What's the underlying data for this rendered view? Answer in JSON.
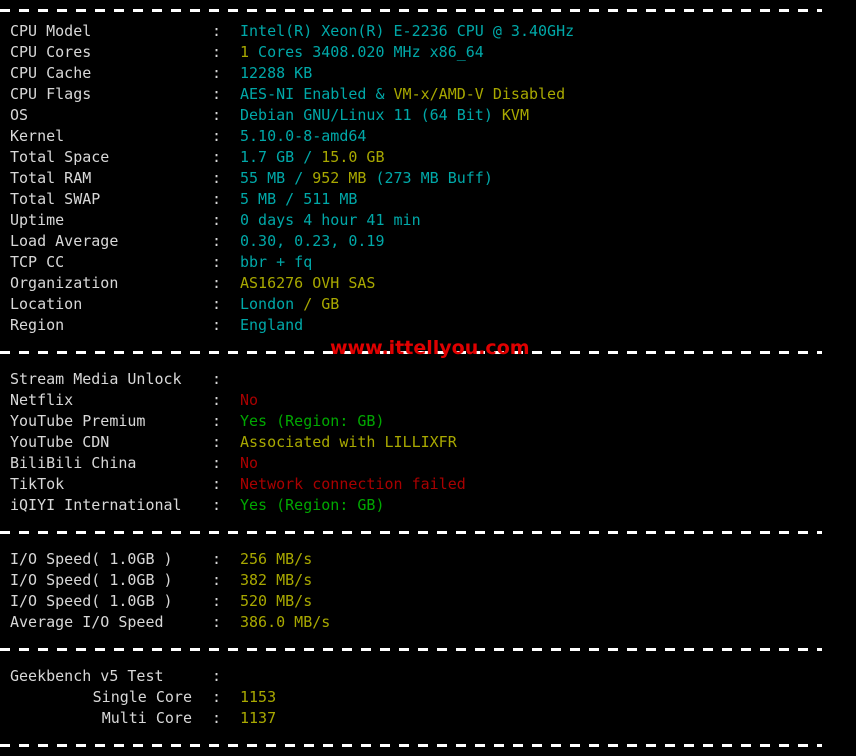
{
  "watermark": {
    "text": "www.ittellyou.com",
    "color": "#e00000"
  },
  "colors": {
    "background": "#000000",
    "label": "#d8d8d8",
    "cyan": "#00a8a8",
    "yellow": "#a8a800",
    "green": "#00a800",
    "red": "#a80000"
  },
  "separator": {
    "char": "-"
  },
  "sections": [
    {
      "id": "system-info",
      "rows": [
        {
          "label": "CPU Model",
          "colon": ":",
          "parts": [
            {
              "text": "Intel(R) Xeon(R) E-2236 CPU @ 3.40GHz",
              "color": "cyan"
            }
          ]
        },
        {
          "label": "CPU Cores",
          "colon": ":",
          "parts": [
            {
              "text": "1",
              "color": "yellow"
            },
            {
              "text": " Cores ",
              "color": "cyan"
            },
            {
              "text": "3408.020",
              "color": "cyan"
            },
            {
              "text": " MHz ",
              "color": "cyan"
            },
            {
              "text": "x86_64",
              "color": "cyan"
            }
          ]
        },
        {
          "label": "CPU Cache",
          "colon": ":",
          "parts": [
            {
              "text": "12288 KB",
              "color": "cyan"
            }
          ]
        },
        {
          "label": "CPU Flags",
          "colon": ":",
          "parts": [
            {
              "text": "AES-NI Enabled",
              "color": "cyan"
            },
            {
              "text": " & ",
              "color": "cyan"
            },
            {
              "text": "VM-x/AMD-V Disabled",
              "color": "yellow"
            }
          ]
        },
        {
          "label": "OS",
          "colon": ":",
          "parts": [
            {
              "text": "Debian GNU/Linux 11 (64 Bit) ",
              "color": "cyan"
            },
            {
              "text": "KVM",
              "color": "yellow"
            }
          ]
        },
        {
          "label": "Kernel",
          "colon": ":",
          "parts": [
            {
              "text": "5.10.0-8-amd64",
              "color": "cyan"
            }
          ]
        },
        {
          "label": "Total Space",
          "colon": ":",
          "parts": [
            {
              "text": "1.7 GB ",
              "color": "cyan"
            },
            {
              "text": "/ ",
              "color": "cyan"
            },
            {
              "text": "15.0 GB",
              "color": "yellow"
            }
          ]
        },
        {
          "label": "Total RAM",
          "colon": ":",
          "parts": [
            {
              "text": "55 MB ",
              "color": "cyan"
            },
            {
              "text": "/ ",
              "color": "cyan"
            },
            {
              "text": "952 MB",
              "color": "yellow"
            },
            {
              "text": " (273 MB Buff)",
              "color": "cyan"
            }
          ]
        },
        {
          "label": "Total SWAP",
          "colon": ":",
          "parts": [
            {
              "text": "5 MB / 511 MB",
              "color": "cyan"
            }
          ]
        },
        {
          "label": "Uptime",
          "colon": ":",
          "parts": [
            {
              "text": "0 days 4 hour 41 min",
              "color": "cyan"
            }
          ]
        },
        {
          "label": "Load Average",
          "colon": ":",
          "parts": [
            {
              "text": "0.30, 0.23, 0.19",
              "color": "cyan"
            }
          ]
        },
        {
          "label": "TCP CC",
          "colon": ":",
          "parts": [
            {
              "text": "bbr + fq",
              "color": "cyan"
            }
          ]
        },
        {
          "label": "Organization",
          "colon": ":",
          "parts": [
            {
              "text": "AS16276 OVH SAS",
              "color": "yellow"
            }
          ]
        },
        {
          "label": "Location",
          "colon": ":",
          "parts": [
            {
              "text": "London ",
              "color": "cyan"
            },
            {
              "text": "/ GB",
              "color": "yellow"
            }
          ]
        },
        {
          "label": "Region",
          "colon": ":",
          "parts": [
            {
              "text": "England",
              "color": "cyan"
            }
          ]
        }
      ]
    },
    {
      "id": "stream-media-unlock",
      "rows": [
        {
          "label": "Stream Media Unlock",
          "colon": ":",
          "parts": []
        },
        {
          "label": "Netflix",
          "colon": ":",
          "parts": [
            {
              "text": "No",
              "color": "red"
            }
          ]
        },
        {
          "label": "YouTube Premium",
          "colon": ":",
          "parts": [
            {
              "text": "Yes (Region: GB)",
              "color": "green"
            }
          ]
        },
        {
          "label": "YouTube CDN",
          "colon": ":",
          "parts": [
            {
              "text": "Associated with LILLIXFR",
              "color": "yellow"
            }
          ]
        },
        {
          "label": "BiliBili China",
          "colon": ":",
          "parts": [
            {
              "text": "No",
              "color": "red"
            }
          ]
        },
        {
          "label": "TikTok",
          "colon": ":",
          "parts": [
            {
              "text": "Network connection failed",
              "color": "red"
            }
          ]
        },
        {
          "label": "iQIYI International",
          "colon": ":",
          "parts": [
            {
              "text": "Yes (Region: GB)",
              "color": "green"
            }
          ]
        }
      ]
    },
    {
      "id": "io-speed",
      "rows": [
        {
          "label": "I/O Speed( 1.0GB )",
          "colon": ":",
          "parts": [
            {
              "text": "256 MB/s",
              "color": "yellow"
            }
          ]
        },
        {
          "label": "I/O Speed( 1.0GB )",
          "colon": ":",
          "parts": [
            {
              "text": "382 MB/s",
              "color": "yellow"
            }
          ]
        },
        {
          "label": "I/O Speed( 1.0GB )",
          "colon": ":",
          "parts": [
            {
              "text": "520 MB/s",
              "color": "yellow"
            }
          ]
        },
        {
          "label": "Average I/O Speed",
          "colon": ":",
          "parts": [
            {
              "text": "386.0 MB/s",
              "color": "yellow"
            }
          ]
        }
      ]
    },
    {
      "id": "geekbench",
      "rows": [
        {
          "label": "Geekbench v5 Test",
          "colon": ":",
          "parts": []
        },
        {
          "label": "Single Core",
          "indent": true,
          "colon": ":",
          "parts": [
            {
              "text": "1153",
              "color": "yellow"
            }
          ]
        },
        {
          "label": "Multi Core",
          "indent": true,
          "colon": ":",
          "parts": [
            {
              "text": "1137",
              "color": "yellow"
            }
          ]
        }
      ]
    }
  ]
}
